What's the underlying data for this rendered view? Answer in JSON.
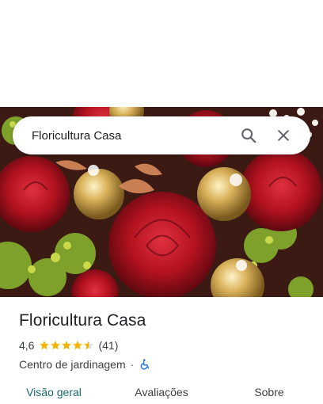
{
  "search": {
    "query": "Floricultura Casa",
    "search_icon": "search-icon",
    "close_icon": "close-icon"
  },
  "hero_photo": "bouquet-red-roses-ferrero-chocolates",
  "place": {
    "name": "Floricultura Casa",
    "rating": "4,6",
    "stars": 4.5,
    "review_count": "(41)",
    "category": "Centro de jardinagem",
    "separator": "·",
    "accessibility_icon": "wheelchair-icon"
  },
  "tabs": [
    {
      "label": "Visão geral",
      "active": true
    },
    {
      "label": "Avaliações",
      "active": false
    },
    {
      "label": "Sobre",
      "active": false
    }
  ],
  "colors": {
    "star": "#f4b400",
    "accent": "#1a6b73",
    "accessibility": "#1a73e8"
  }
}
